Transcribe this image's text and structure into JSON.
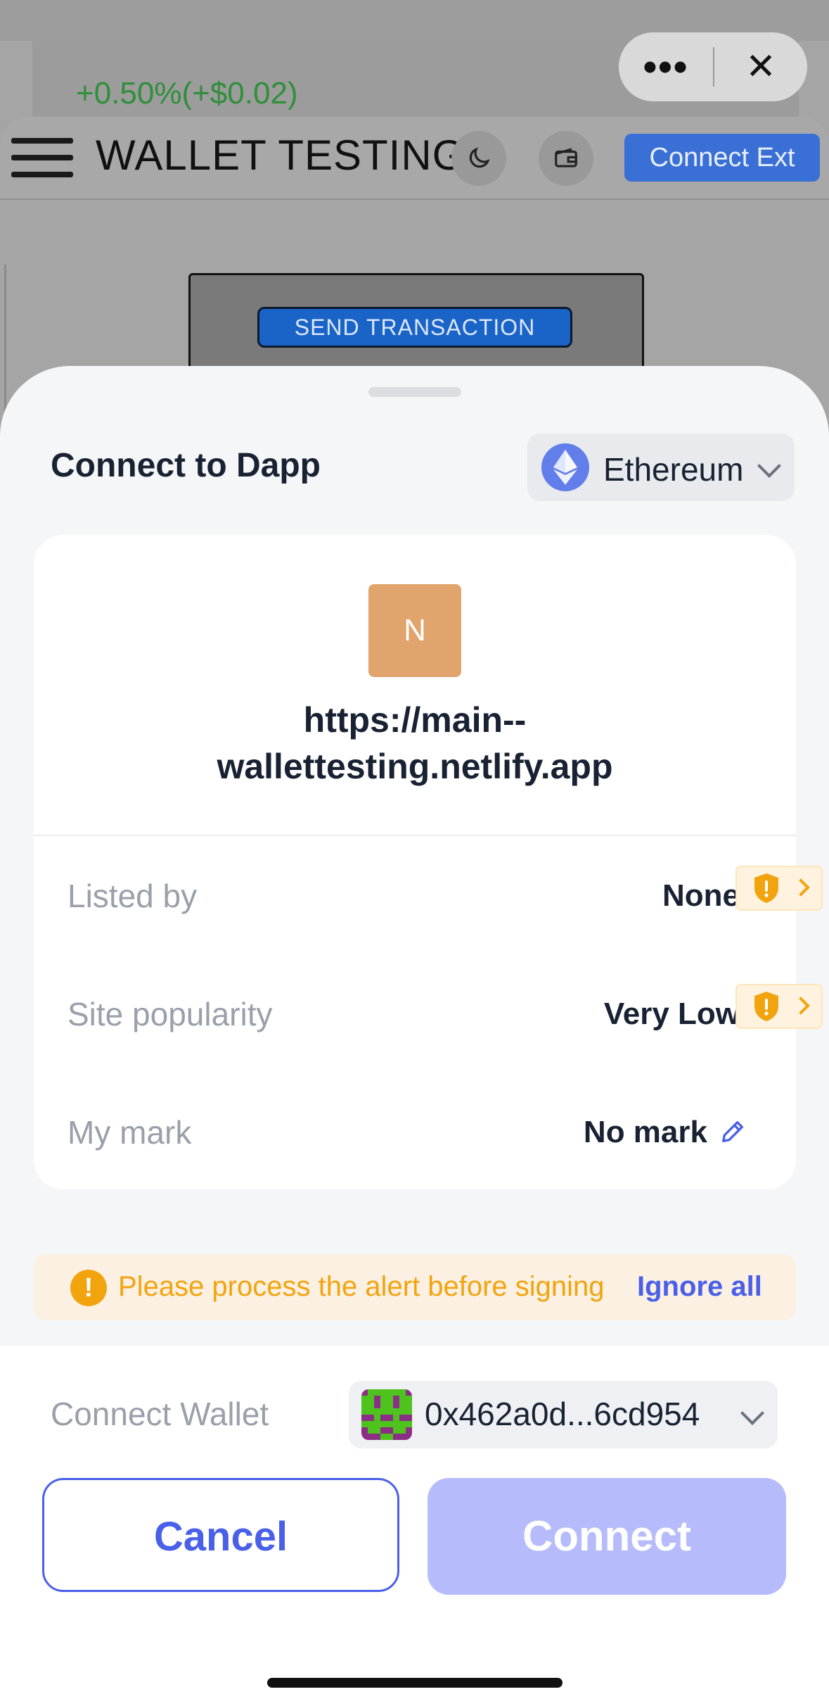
{
  "background_page": {
    "price_change": "+0.50%(+$0.02)",
    "site_title": "WALLET TESTING",
    "connect_ext_label": "Connect Ext",
    "send_transaction_label": "SEND TRANSACTION",
    "browser_more_icon": "more-dots-icon",
    "browser_close_icon": "close-icon",
    "theme_icon": "moon-icon",
    "wallet_icon": "wallet-icon"
  },
  "sheet": {
    "title": "Connect to Dapp",
    "chain": {
      "label": "Ethereum",
      "icon": "ethereum-icon",
      "color": "#627EEA"
    },
    "site": {
      "avatar_letter": "N",
      "avatar_color": "#E0A46C",
      "url_line1": "https://main--",
      "url_line2": "wallettesting.netlify.app"
    },
    "rows": [
      {
        "label": "Listed by",
        "value": "None",
        "warning": true
      },
      {
        "label": "Site popularity",
        "value": "Very Low",
        "warning": true
      },
      {
        "label": "My mark",
        "value": "No mark",
        "editable": true
      }
    ],
    "alert": {
      "text": "Please process the alert before signing",
      "action": "Ignore all",
      "color": "#F2A40E"
    },
    "wallet": {
      "label": "Connect Wallet",
      "address": "0x462a0d...6cd954"
    },
    "buttons": {
      "cancel": "Cancel",
      "connect": "Connect"
    },
    "accent_color": "#4A60E8"
  }
}
